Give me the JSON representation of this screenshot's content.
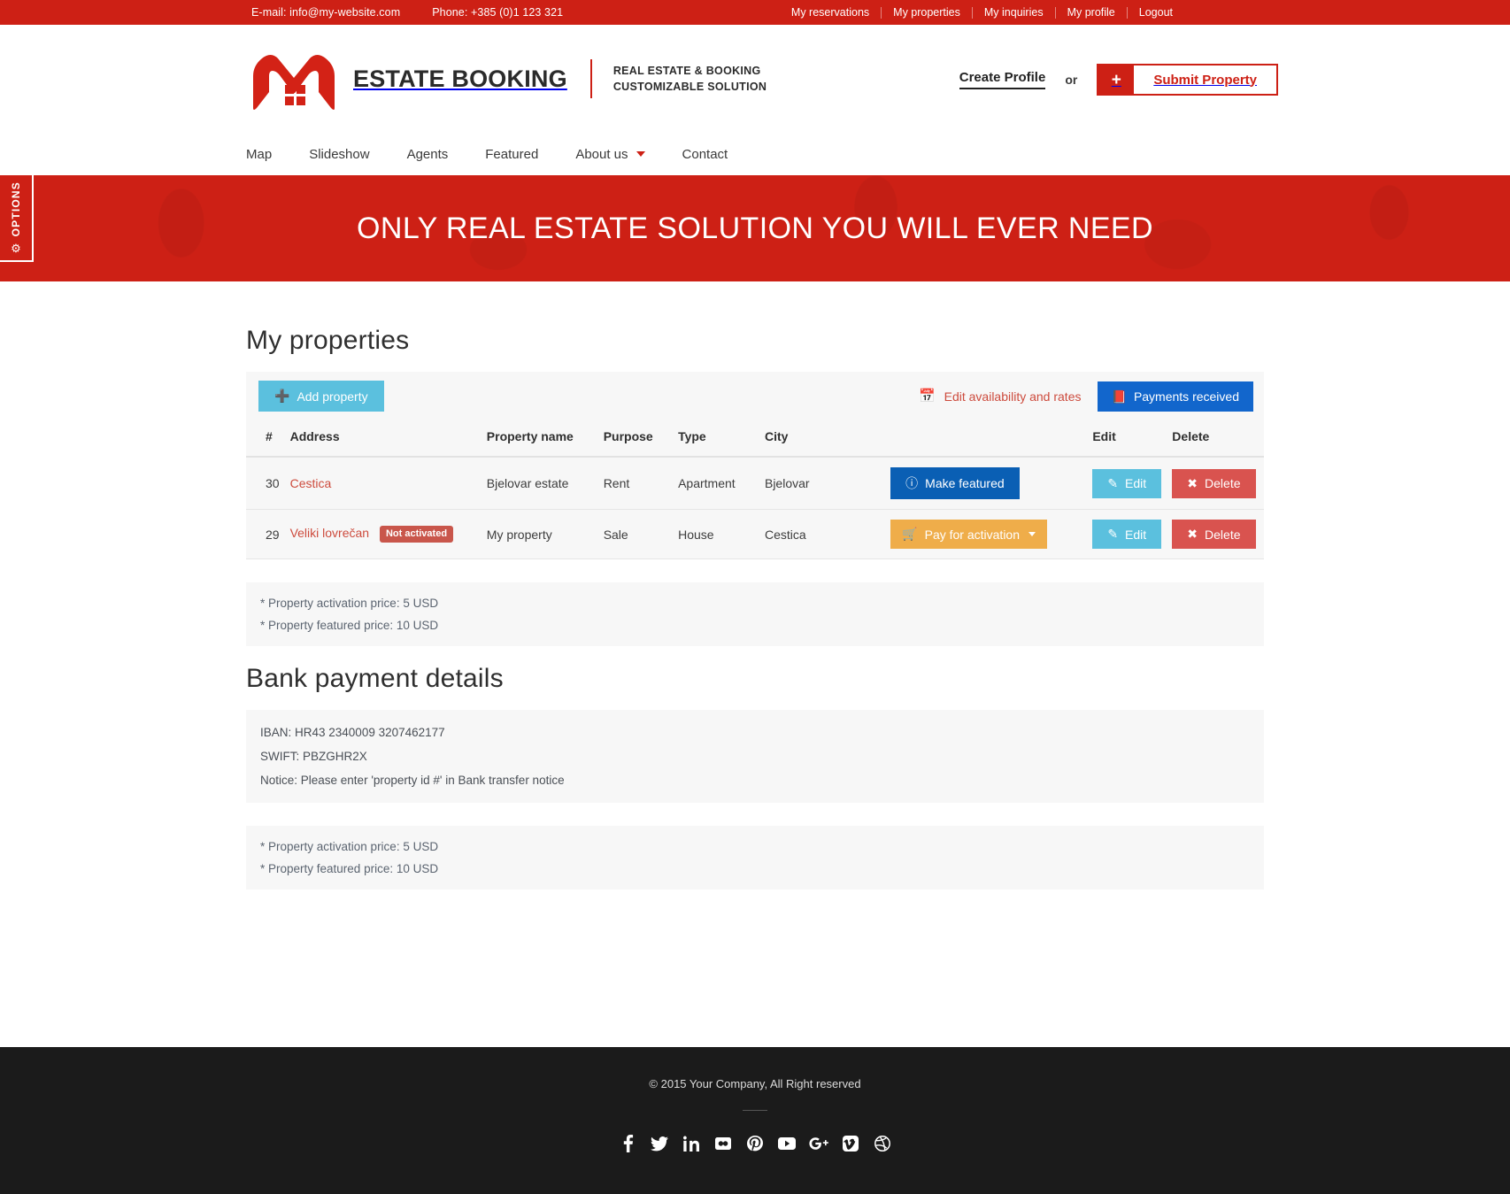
{
  "topbar": {
    "email_label": "E-mail: info@my-website.com",
    "phone_label": "Phone: +385 (0)1 123 321",
    "links": [
      {
        "label": "My reservations"
      },
      {
        "label": "My properties"
      },
      {
        "label": "My inquiries"
      },
      {
        "label": "My profile"
      },
      {
        "label": "Logout"
      }
    ]
  },
  "header": {
    "logo_icon": "house-w-logo-icon",
    "brand": "ESTATE BOOKING",
    "tagline_line1": "REAL ESTATE & BOOKING",
    "tagline_line2": "CUSTOMIZABLE SOLUTION",
    "create_profile": "Create Profile",
    "or": "or",
    "plus": "+",
    "submit_property": "Submit Property"
  },
  "nav": {
    "items": [
      {
        "label": "Map",
        "has_caret": false
      },
      {
        "label": "Slideshow",
        "has_caret": false
      },
      {
        "label": "Agents",
        "has_caret": false
      },
      {
        "label": "Featured",
        "has_caret": false
      },
      {
        "label": "About us",
        "has_caret": true
      },
      {
        "label": "Contact",
        "has_caret": false
      }
    ]
  },
  "options_tab": {
    "label": "OPTIONS",
    "icon": "gear-icon",
    "glyph": "⚙"
  },
  "hero": {
    "title": "ONLY REAL ESTATE SOLUTION YOU WILL EVER NEED"
  },
  "main": {
    "page_title": "My properties",
    "toolbar": {
      "add_property": "Add property",
      "add_icon": "plus-icon",
      "edit_availability": "Edit availability and rates",
      "calendar_icon": "calendar-icon",
      "payments_received": "Payments received",
      "payments_icon": "book-icon"
    },
    "table": {
      "columns": [
        "#",
        "Address",
        "Property name",
        "Purpose",
        "Type",
        "City",
        "",
        "Edit",
        "Delete"
      ],
      "rows": [
        {
          "num": "30",
          "address": "Cestica",
          "badge": "",
          "property_name": "Bjelovar estate",
          "purpose": "Rent",
          "type": "Apartment",
          "city": "Bjelovar",
          "action_label": "Make featured",
          "action_icon": "info-circle-icon",
          "action_style": "featured",
          "edit_label": "Edit",
          "delete_label": "Delete"
        },
        {
          "num": "29",
          "address": "Veliki lovrečan",
          "badge": "Not activated",
          "property_name": "My property",
          "purpose": "Sale",
          "type": "House",
          "city": "Cestica",
          "action_label": "Pay for activation",
          "action_icon": "cart-icon",
          "action_style": "payact",
          "edit_label": "Edit",
          "delete_label": "Delete"
        }
      ]
    },
    "notes_top": [
      "* Property activation price: 5 USD",
      "* Property featured price: 10 USD"
    ],
    "bank_title": "Bank payment details",
    "bank_details": [
      "IBAN: HR43 2340009 3207462177",
      "SWIFT: PBZGHR2X",
      "Notice: Please enter 'property id #' in Bank transfer notice"
    ],
    "notes_bottom": [
      "* Property activation price: 5 USD",
      "* Property featured price: 10 USD"
    ]
  },
  "footer": {
    "copyright": "© 2015 Your Company, All Right reserved",
    "social": [
      {
        "name": "facebook-icon"
      },
      {
        "name": "twitter-icon"
      },
      {
        "name": "linkedin-icon"
      },
      {
        "name": "flickr-icon"
      },
      {
        "name": "pinterest-icon"
      },
      {
        "name": "youtube-icon"
      },
      {
        "name": "google-plus-icon"
      },
      {
        "name": "vimeo-icon"
      },
      {
        "name": "dribbble-icon"
      }
    ]
  },
  "colors": {
    "brand_red": "#cd2015",
    "link_red": "#cd4b3d",
    "info_blue": "#5bc0de",
    "primary_blue": "#1266cc",
    "featured_blue": "#0a5fb4",
    "warning_orange": "#efad4a",
    "danger_red": "#d9534f",
    "panel_gray": "#f7f7f7",
    "footer_dark": "#1b1b1b"
  }
}
